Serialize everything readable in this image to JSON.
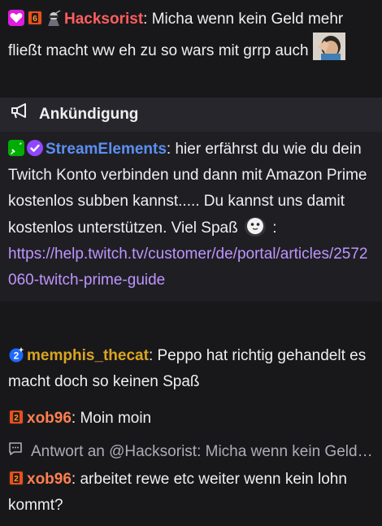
{
  "messages": [
    {
      "user": "Hacksorist",
      "user_color": "#ff5d5d",
      "text": ": Micha wenn kein Geld mehr fließt macht ww eh zu so wars mit grrp auch",
      "badges": [
        "prime-heart-icon",
        "sub-month-6-icon",
        "ninja-avatar-icon"
      ],
      "emote": "facepalm-emote-icon"
    }
  ],
  "announcement": {
    "header_label": "Ankündigung",
    "user": "StreamElements",
    "user_color": "#5c8ff2",
    "text_before_emote": ": hier erfährst du wie du dein Twitch Konto verbinden und dann mit Amazon Prime kostenlos subben kannst..... Du kannst uns damit kostenlos unterstützen. Viel Spaß",
    "text_after_emote": " :",
    "link": "https://help.twitch.tv/customer/de/portal/articles/2572060-twitch-prime-guide",
    "badges": [
      "moderator-sword-icon",
      "verified-check-icon"
    ],
    "emote": "ghost-emote-icon"
  },
  "message_memphis": {
    "user": "memphis_thecat",
    "user_color": "#daa520",
    "text": ": Peppo hat richtig gehandelt es macht doch so keinen Spaß",
    "badges": [
      "sub-gift-2-icon"
    ]
  },
  "message_xob_1": {
    "user": "xob96",
    "user_color": "#ff7f50",
    "text": ": Moin moin",
    "badges": [
      "sub-month-2-icon"
    ]
  },
  "reply": {
    "text": "Antwort an @Hacksorist: Micha wenn kein Geld mehr fließt macht ww eh zu so wars mit grrp auch"
  },
  "message_xob_2": {
    "user": "xob96",
    "user_color": "#ff7f50",
    "text": ": arbeitet rewe etc weiter wenn kein lohn kommt?",
    "badges": [
      "sub-month-2-icon"
    ]
  },
  "colors": {
    "background": "#18181b",
    "announcement_header_bg": "#26262c",
    "announcement_body_bg": "#1f1f23",
    "link": "#bf94ff",
    "reply_text": "#adadb8"
  }
}
